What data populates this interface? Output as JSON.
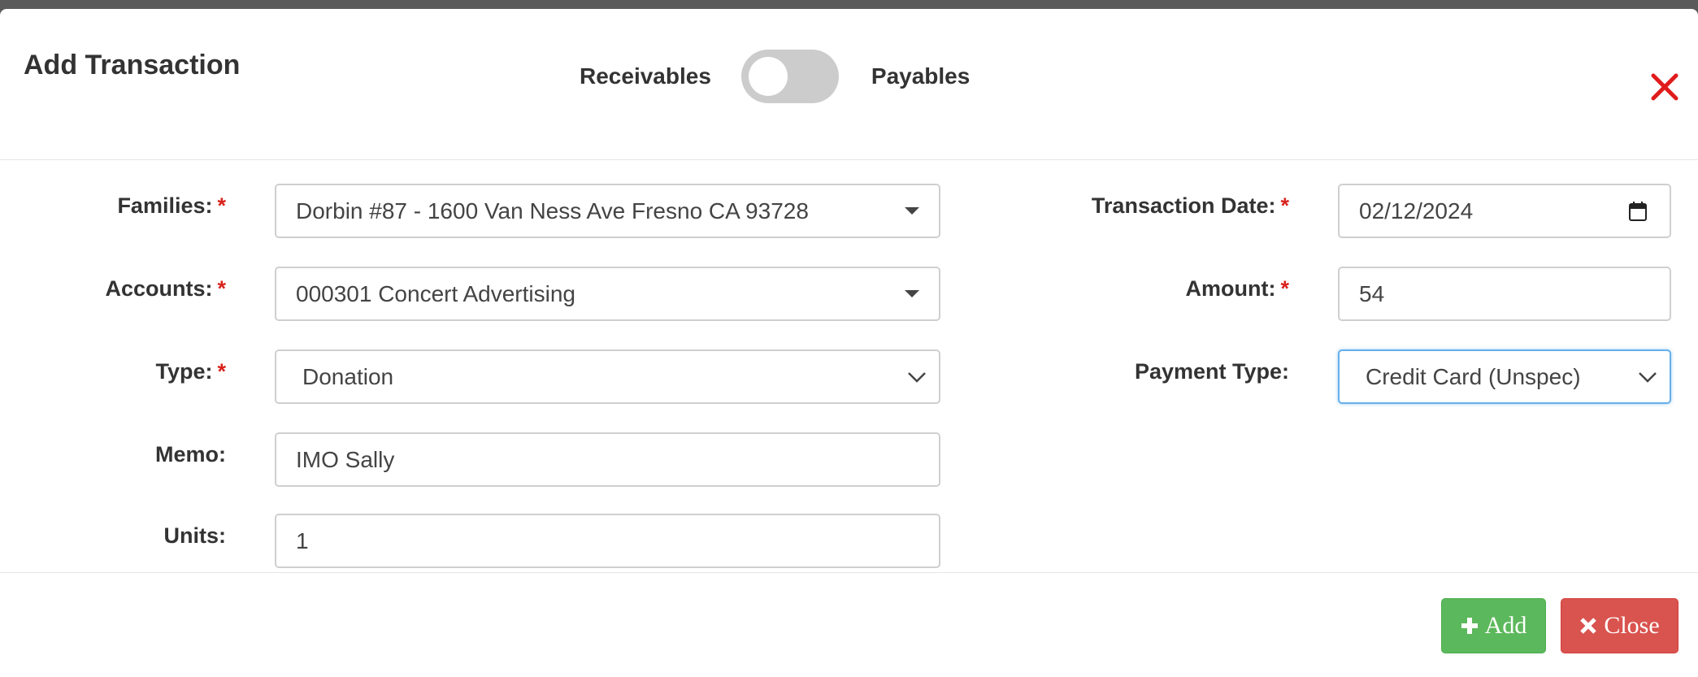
{
  "header": {
    "title": "Add Transaction",
    "toggle_left_label": "Receivables",
    "toggle_right_label": "Payables"
  },
  "form": {
    "families": {
      "label": "Families:",
      "required": "*",
      "value": "Dorbin #87 - 1600 Van Ness Ave Fresno CA 93728"
    },
    "accounts": {
      "label": "Accounts:",
      "required": "*",
      "value": "000301 Concert Advertising"
    },
    "type": {
      "label": "Type:",
      "required": "*",
      "value": "Donation"
    },
    "memo": {
      "label": "Memo:",
      "value": "IMO Sally"
    },
    "units": {
      "label": "Units:",
      "value": "1"
    },
    "transaction_date": {
      "label": "Transaction Date:",
      "required": "*",
      "value": "02/12/2024"
    },
    "amount": {
      "label": "Amount:",
      "required": "*",
      "value": "54"
    },
    "payment_type": {
      "label": "Payment Type:",
      "value": "Credit Card (Unspec)"
    }
  },
  "footer": {
    "add_label": "Add",
    "close_label": "Close"
  },
  "colors": {
    "required": "#d9231e",
    "close_x": "#e01b1b",
    "add_button": "#5cb85c",
    "close_button": "#d9534f",
    "focus_border": "#66afe9"
  },
  "icons": {
    "close": "close-x-icon",
    "calendar": "calendar-icon",
    "dropdown": "caret-down-icon",
    "select": "chevron-down-icon",
    "add": "plus-icon",
    "close_button": "times-icon"
  }
}
